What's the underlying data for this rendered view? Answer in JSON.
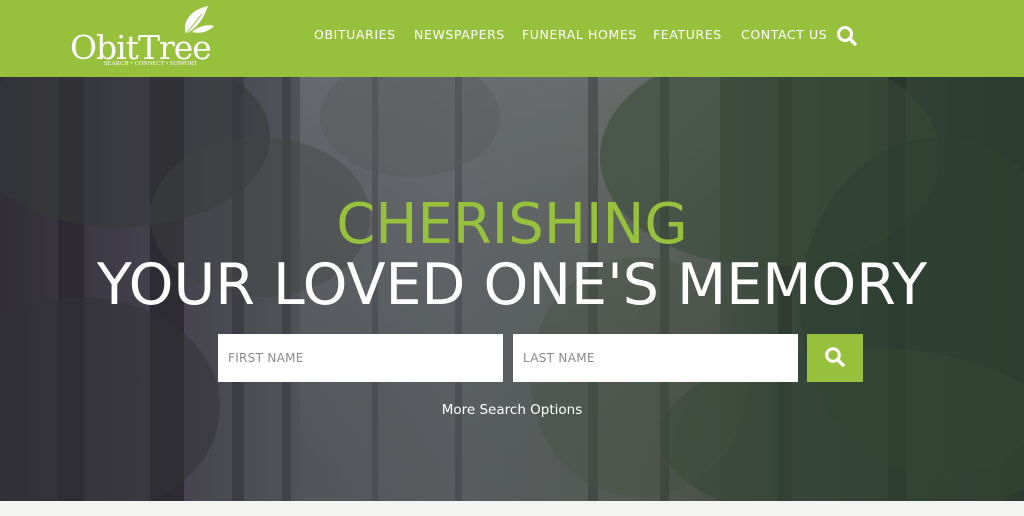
{
  "brand": {
    "name": "ObitTree",
    "tagline": "SEARCH • CONNECT • SUPPORT",
    "color": "#97c13c"
  },
  "nav": {
    "items": [
      {
        "label": "OBITUARIES"
      },
      {
        "label": "NEWSPAPERS"
      },
      {
        "label": "FUNERAL HOMES"
      },
      {
        "label": "FEATURES"
      },
      {
        "label": "CONTACT US"
      }
    ],
    "search_icon": "search-icon"
  },
  "hero": {
    "headline_accent": "CHERISHING",
    "headline_main": "YOUR LOVED ONE'S MEMORY",
    "accent_color": "#97c13c",
    "first_name_placeholder": "FIRST NAME",
    "last_name_placeholder": "LAST NAME",
    "search_icon": "search-icon",
    "more_options_label": "More Search Options"
  }
}
